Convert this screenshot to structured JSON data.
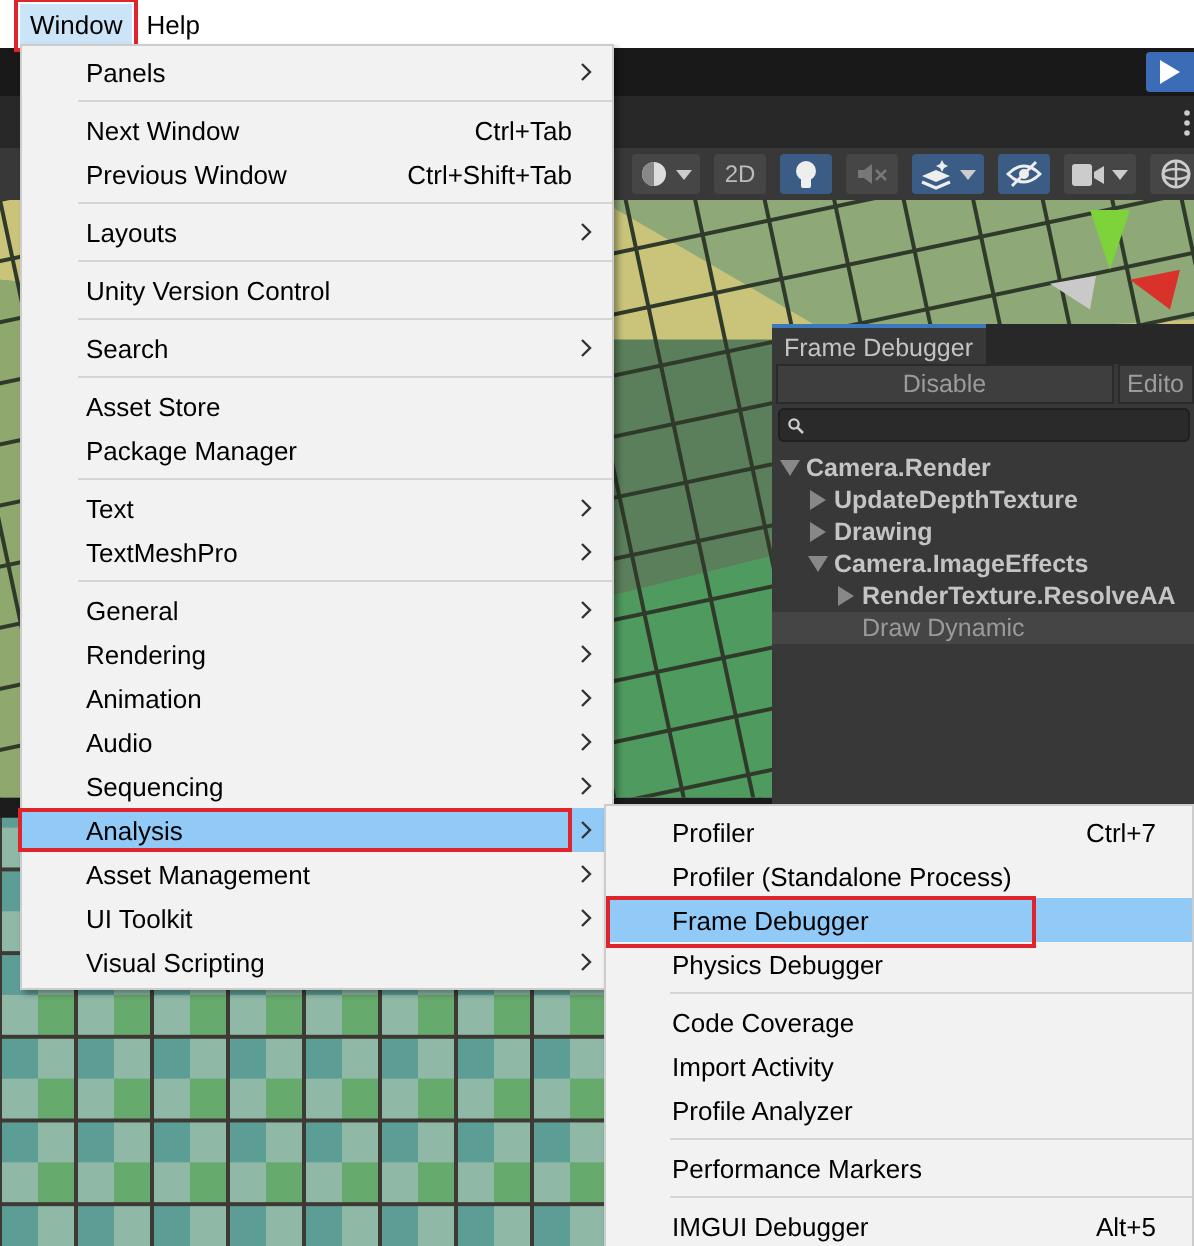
{
  "menubar": [
    {
      "label": "Window",
      "selected": true,
      "annotated": true
    },
    {
      "label": "Help",
      "selected": false,
      "annotated": false
    }
  ],
  "scene_toolbar": [
    {
      "kind": "shading",
      "selected": false
    },
    {
      "kind": "mode",
      "label": "2D",
      "selected": false
    },
    {
      "kind": "lighting",
      "selected": true
    },
    {
      "kind": "audio",
      "selected": false
    },
    {
      "kind": "effects",
      "selected": true
    },
    {
      "kind": "visibility",
      "selected": true
    },
    {
      "kind": "camera",
      "selected": false
    },
    {
      "kind": "gizmos",
      "selected": false
    }
  ],
  "frame_debugger": {
    "tab": "Frame Debugger",
    "buttons": [
      "Disable",
      "Edito"
    ],
    "tree": [
      {
        "label": "Camera.Render",
        "expanded": true,
        "selected": false,
        "children": [
          {
            "label": "UpdateDepthTexture",
            "expanded": false,
            "selected": false
          },
          {
            "label": "Drawing",
            "expanded": false,
            "selected": false
          },
          {
            "label": "Camera.ImageEffects",
            "expanded": true,
            "selected": false,
            "children": [
              {
                "label": "RenderTexture.ResolveAA",
                "expanded": false,
                "selected": false
              },
              {
                "label": "Draw Dynamic",
                "selected": true
              }
            ]
          }
        ]
      }
    ]
  },
  "window_menu": [
    {
      "kind": "item",
      "label": "Panels",
      "submenu": true,
      "selected": false,
      "annotated": false
    },
    {
      "kind": "separator"
    },
    {
      "kind": "item",
      "label": "Next Window",
      "shortcut": "Ctrl+Tab",
      "submenu": false,
      "selected": false,
      "annotated": false
    },
    {
      "kind": "item",
      "label": "Previous Window",
      "shortcut": "Ctrl+Shift+Tab",
      "submenu": false,
      "selected": false,
      "annotated": false
    },
    {
      "kind": "separator"
    },
    {
      "kind": "item",
      "label": "Layouts",
      "submenu": true,
      "selected": false,
      "annotated": false
    },
    {
      "kind": "separator"
    },
    {
      "kind": "item",
      "label": "Unity Version Control",
      "submenu": false,
      "selected": false,
      "annotated": false
    },
    {
      "kind": "separator"
    },
    {
      "kind": "item",
      "label": "Search",
      "submenu": true,
      "selected": false,
      "annotated": false
    },
    {
      "kind": "separator"
    },
    {
      "kind": "item",
      "label": "Asset Store",
      "submenu": false,
      "selected": false,
      "annotated": false
    },
    {
      "kind": "item",
      "label": "Package Manager",
      "submenu": false,
      "selected": false,
      "annotated": false
    },
    {
      "kind": "separator"
    },
    {
      "kind": "item",
      "label": "Text",
      "submenu": true,
      "selected": false,
      "annotated": false
    },
    {
      "kind": "item",
      "label": "TextMeshPro",
      "submenu": true,
      "selected": false,
      "annotated": false
    },
    {
      "kind": "separator"
    },
    {
      "kind": "item",
      "label": "General",
      "submenu": true,
      "selected": false,
      "annotated": false
    },
    {
      "kind": "item",
      "label": "Rendering",
      "submenu": true,
      "selected": false,
      "annotated": false
    },
    {
      "kind": "item",
      "label": "Animation",
      "submenu": true,
      "selected": false,
      "annotated": false
    },
    {
      "kind": "item",
      "label": "Audio",
      "submenu": true,
      "selected": false,
      "annotated": false
    },
    {
      "kind": "item",
      "label": "Sequencing",
      "submenu": true,
      "selected": false,
      "annotated": false
    },
    {
      "kind": "item",
      "label": "Analysis",
      "submenu": true,
      "selected": true,
      "annotated": true
    },
    {
      "kind": "item",
      "label": "Asset Management",
      "submenu": true,
      "selected": false,
      "annotated": false
    },
    {
      "kind": "item",
      "label": "UI Toolkit",
      "submenu": true,
      "selected": false,
      "annotated": false
    },
    {
      "kind": "item",
      "label": "Visual Scripting",
      "submenu": true,
      "selected": false,
      "annotated": false
    }
  ],
  "analysis_submenu": [
    {
      "kind": "item",
      "label": "Profiler",
      "shortcut": "Ctrl+7",
      "submenu": false,
      "selected": false,
      "annotated": false
    },
    {
      "kind": "item",
      "label": "Profiler (Standalone Process)",
      "submenu": false,
      "selected": false,
      "annotated": false
    },
    {
      "kind": "item",
      "label": "Frame Debugger",
      "submenu": false,
      "selected": true,
      "annotated": true
    },
    {
      "kind": "item",
      "label": "Physics Debugger",
      "submenu": false,
      "selected": false,
      "annotated": false
    },
    {
      "kind": "separator"
    },
    {
      "kind": "item",
      "label": "Code Coverage",
      "submenu": false,
      "selected": false,
      "annotated": false
    },
    {
      "kind": "item",
      "label": "Import Activity",
      "submenu": false,
      "selected": false,
      "annotated": false
    },
    {
      "kind": "item",
      "label": "Profile Analyzer",
      "submenu": false,
      "selected": false,
      "annotated": false
    },
    {
      "kind": "separator"
    },
    {
      "kind": "item",
      "label": "Performance Markers",
      "submenu": false,
      "selected": false,
      "annotated": false
    },
    {
      "kind": "separator"
    },
    {
      "kind": "item",
      "label": "IMGUI Debugger",
      "shortcut": "Alt+5",
      "submenu": false,
      "selected": false,
      "annotated": false
    }
  ]
}
